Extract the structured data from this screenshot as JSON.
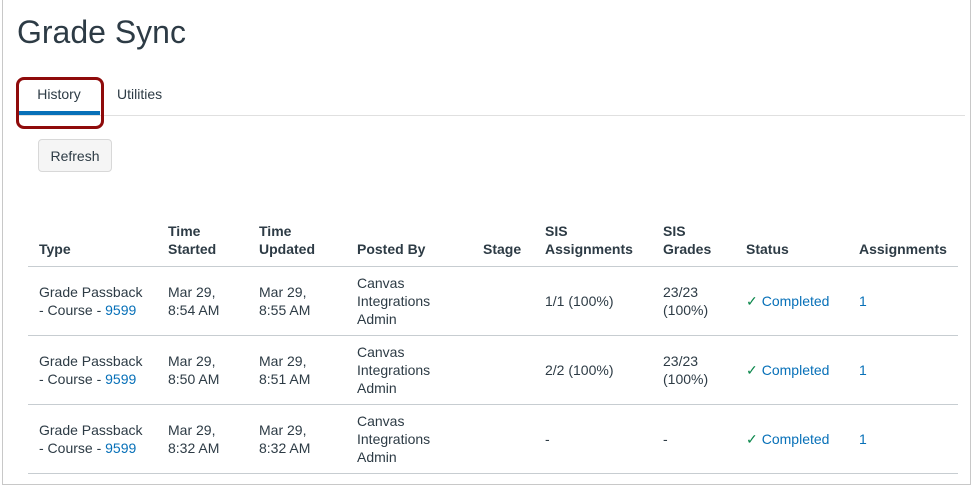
{
  "page_title": "Grade Sync",
  "tabs": [
    {
      "label": "History",
      "active": true
    },
    {
      "label": "Utilities",
      "active": false
    }
  ],
  "refresh_label": "Refresh",
  "table": {
    "headers": [
      "Type",
      "Time Started",
      "Time Updated",
      "Posted By",
      "Stage",
      "SIS Assignments",
      "SIS Grades",
      "Status",
      "Assignments"
    ],
    "rows": [
      {
        "type": "Grade Passback - Course - ",
        "course_id": "9599",
        "started": "Mar 29, 8:54 AM",
        "updated": "Mar 29, 8:55 AM",
        "posted_by": "Canvas Integrations Admin",
        "stage": "",
        "sis_assignments": "1/1 (100%)",
        "sis_grades": "23/23 (100%)",
        "status": "Completed",
        "assignments": "1"
      },
      {
        "type": "Grade Passback - Course - ",
        "course_id": "9599",
        "started": "Mar 29, 8:50 AM",
        "updated": "Mar 29, 8:51 AM",
        "posted_by": "Canvas Integrations Admin",
        "stage": "",
        "sis_assignments": "2/2 (100%)",
        "sis_grades": "23/23 (100%)",
        "status": "Completed",
        "assignments": "1"
      },
      {
        "type": "Grade Passback - Course - ",
        "course_id": "9599",
        "started": "Mar 29, 8:32 AM",
        "updated": "Mar 29, 8:32 AM",
        "posted_by": "Canvas Integrations Admin",
        "stage": "",
        "sis_assignments": "-",
        "sis_grades": "-",
        "status": "Completed",
        "assignments": "1"
      }
    ]
  },
  "colors": {
    "link": "#0770b8",
    "success": "#0b874b",
    "highlight": "#8f0b0b",
    "tab_active": "#0770b8"
  }
}
